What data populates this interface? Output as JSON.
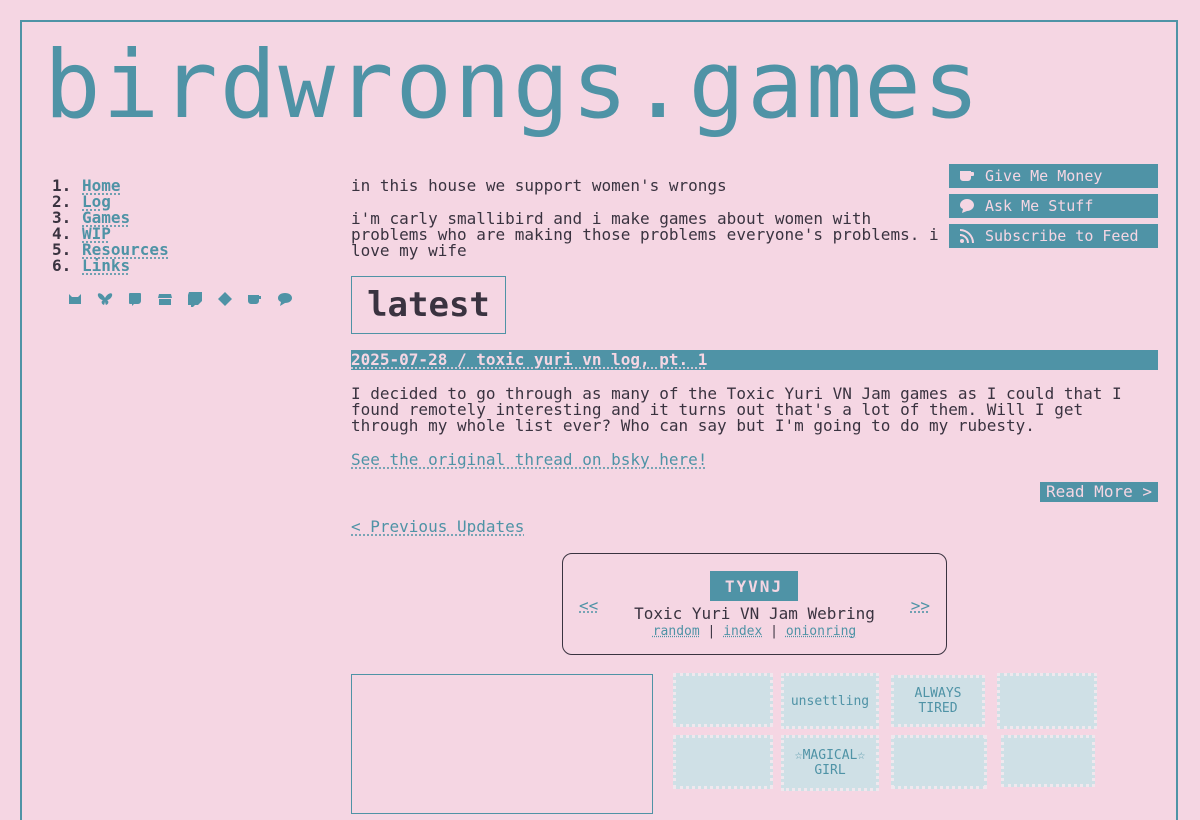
{
  "site": {
    "title": "birdwrongs.games"
  },
  "nav": [
    {
      "num": "1.",
      "label": "Home"
    },
    {
      "num": "2.",
      "label": "Log"
    },
    {
      "num": "3.",
      "label": "Games"
    },
    {
      "num": "4.",
      "label": "WIP"
    },
    {
      "num": "5.",
      "label": "Resources"
    },
    {
      "num": "6.",
      "label": "Links"
    }
  ],
  "social_icons": [
    "neocities-icon",
    "bluesky-icon",
    "mastodon-icon",
    "itch-icon",
    "twitch-icon",
    "git-icon",
    "kofi-icon",
    "chat-icon"
  ],
  "intro": {
    "tagline": "in this house we support women's wrongs",
    "bio": "i'm carly smallibird and i make games about women with problems who are making those problems everyone's problems. i love my wife"
  },
  "side_buttons": [
    {
      "icon": "coffee-cup-icon",
      "label": "Give Me Money"
    },
    {
      "icon": "speech-bubble-icon",
      "label": "Ask Me Stuff"
    },
    {
      "icon": "rss-icon",
      "label": "Subscribe to Feed"
    }
  ],
  "latest": {
    "heading": "latest",
    "post_title": "2025-07-28 / toxic yuri vn log, pt. 1",
    "post_body": "I decided to go through as many of the Toxic Yuri VN Jam games as I could that I found remotely interesting and it turns out that's a lot of them. Will I get through my whole list ever? Who can say but I'm going to do my rubesty.",
    "original_link": "See the original thread on bsky here!",
    "read_more": "Read More >",
    "previous": "< Previous Updates"
  },
  "webring": {
    "prev": "<<",
    "next": ">>",
    "logo": "TYVNJ",
    "title": "Toxic Yuri VN Jam Webring",
    "links": [
      "random",
      "index",
      "onionring"
    ],
    "sep": "|"
  },
  "stamps": [
    {
      "name": "stamp-computer-heart",
      "text": ""
    },
    {
      "name": "stamp-unsettling",
      "text": "unsettling"
    },
    {
      "name": "stamp-always-tired",
      "text": "ALWAYS TIRED"
    },
    {
      "name": "stamp-anime-girls",
      "text": ""
    },
    {
      "name": "stamp-smiley",
      "text": ""
    },
    {
      "name": "stamp-magical-girl",
      "text": "☆MAGICAL☆ GIRL"
    },
    {
      "name": "stamp-faded",
      "text": ""
    },
    {
      "name": "stamp-books",
      "text": ""
    }
  ],
  "colors": {
    "background": "#f5d6e3",
    "accent": "#4f93a6",
    "text": "#3a3340"
  }
}
